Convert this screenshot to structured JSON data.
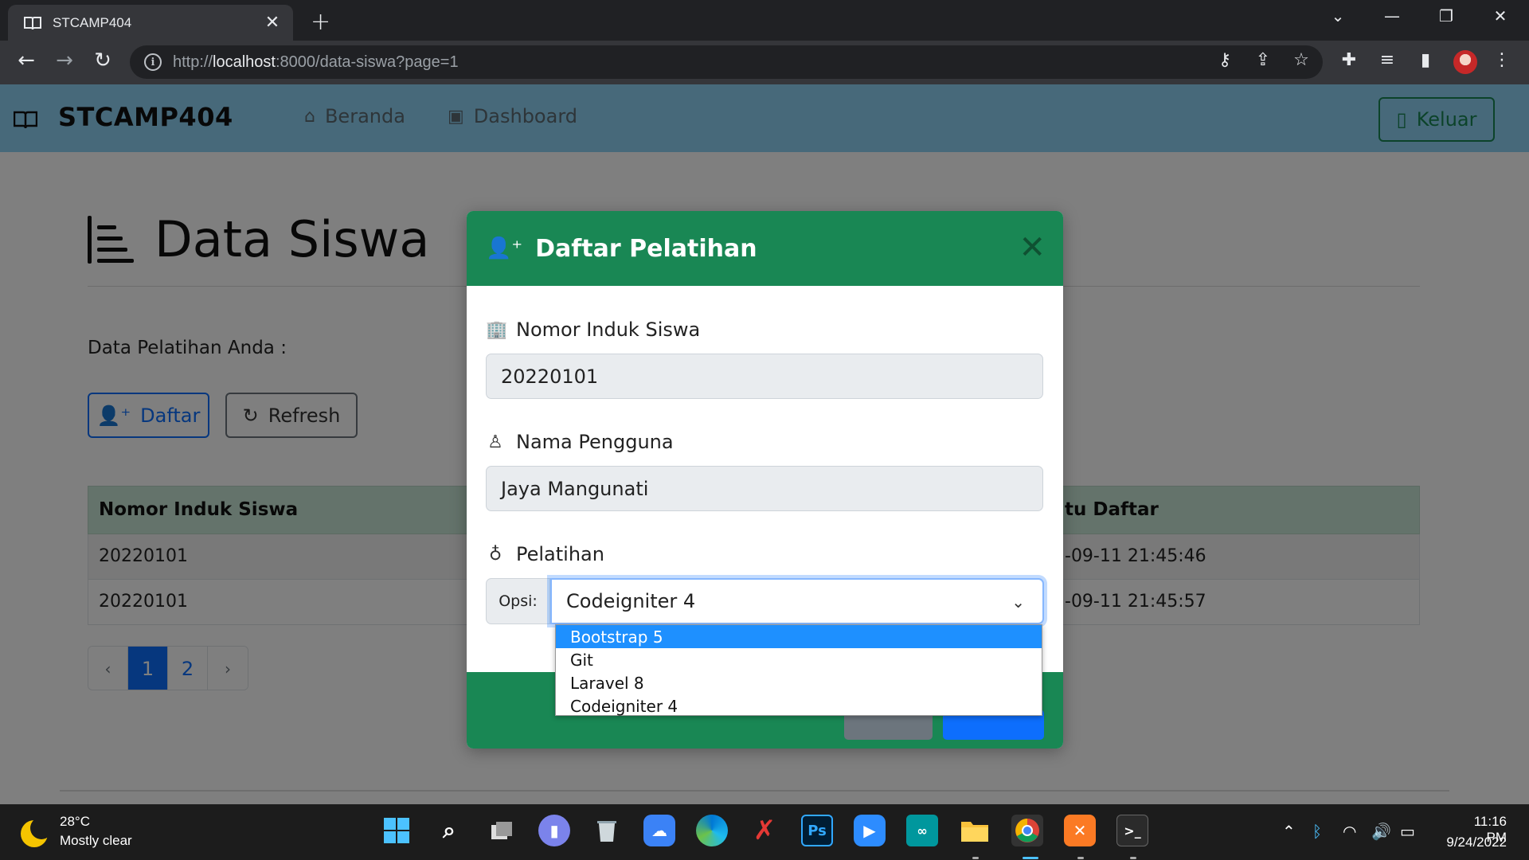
{
  "browser": {
    "tab_title": "STCAMP404",
    "tab_close": "✕",
    "new_tab": "+",
    "url_prefix": "http://",
    "url_host": "localhost",
    "url_rest": ":8000/data-siswa?page=1"
  },
  "navbar": {
    "brand": "STCAMP404",
    "links": [
      {
        "label": "Beranda",
        "icon": "home-icon"
      },
      {
        "label": "Dashboard",
        "icon": "dashboard-icon"
      }
    ],
    "logout_label": "Keluar"
  },
  "page": {
    "title": "Data Siswa",
    "subtitle": "Data Pelatihan Anda :",
    "buttons": {
      "daftar": "Daftar",
      "refresh": "Refresh"
    },
    "table": {
      "headers": [
        "Nomor Induk Siswa",
        "tu Daftar"
      ],
      "rows": [
        [
          "20220101",
          "-09-11 21:45:46"
        ],
        [
          "20220101",
          "-09-11 21:45:57"
        ]
      ]
    },
    "pagination": {
      "prev": "‹",
      "pages": [
        "1",
        "2"
      ],
      "next": "›",
      "active": "1"
    }
  },
  "modal": {
    "title": "Daftar Pelatihan",
    "close": "✕",
    "nis_label": "Nomor Induk Siswa",
    "nis_value": "20220101",
    "name_label": "Nama Pengguna",
    "name_value": "Jaya Mangunati",
    "training_label": "Pelatihan",
    "option_prefix": "Opsi:",
    "selected_option": "Codeigniter 4",
    "options": [
      "Bootstrap 5",
      "Git",
      "Laravel 8",
      "Codeigniter 4"
    ],
    "highlighted_option": "Bootstrap 5"
  },
  "taskbar": {
    "weather_temp": "28°C",
    "weather_desc": "Mostly clear",
    "time": "11:16 PM",
    "date": "9/24/2022"
  },
  "colors": {
    "navbar": "#8fd3f4",
    "modal_header": "#198754",
    "primary": "#0d6efd",
    "dropdown_highlight": "#1e90ff"
  }
}
